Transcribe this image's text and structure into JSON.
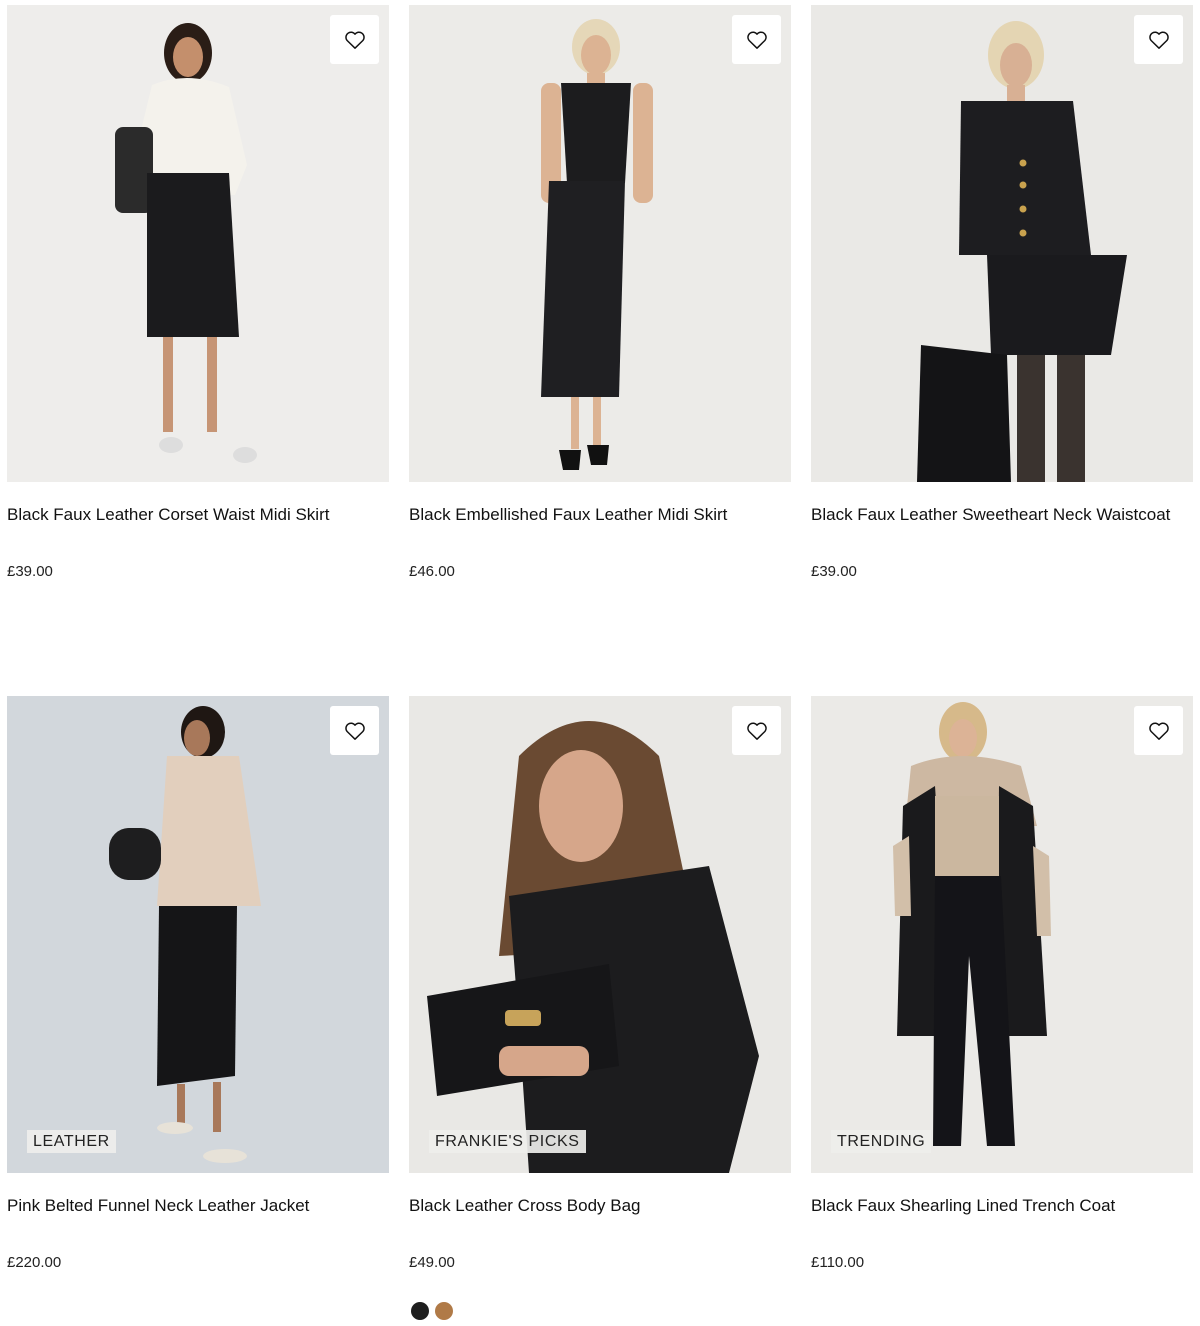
{
  "products": [
    {
      "title": "Black Faux Leather Corset Waist Midi Skirt",
      "price": "£39.00",
      "tag": ""
    },
    {
      "title": "Black Embellished Faux Leather Midi Skirt",
      "price": "£46.00",
      "tag": ""
    },
    {
      "title": "Black Faux Leather Sweetheart Neck Waistcoat",
      "price": "£39.00",
      "tag": ""
    },
    {
      "title": "Pink Belted Funnel Neck Leather Jacket",
      "price": "£220.00",
      "tag": "LEATHER"
    },
    {
      "title": "Black Leather Cross Body Bag",
      "price": "£49.00",
      "tag": "FRANKIE'S PICKS",
      "swatches": [
        "#1e1e1e",
        "#b07a47"
      ]
    },
    {
      "title": "Black Faux Shearling Lined Trench Coat",
      "price": "£110.00",
      "tag": "TRENDING"
    }
  ],
  "icons": {
    "wishlist": "heart-outline-icon"
  }
}
